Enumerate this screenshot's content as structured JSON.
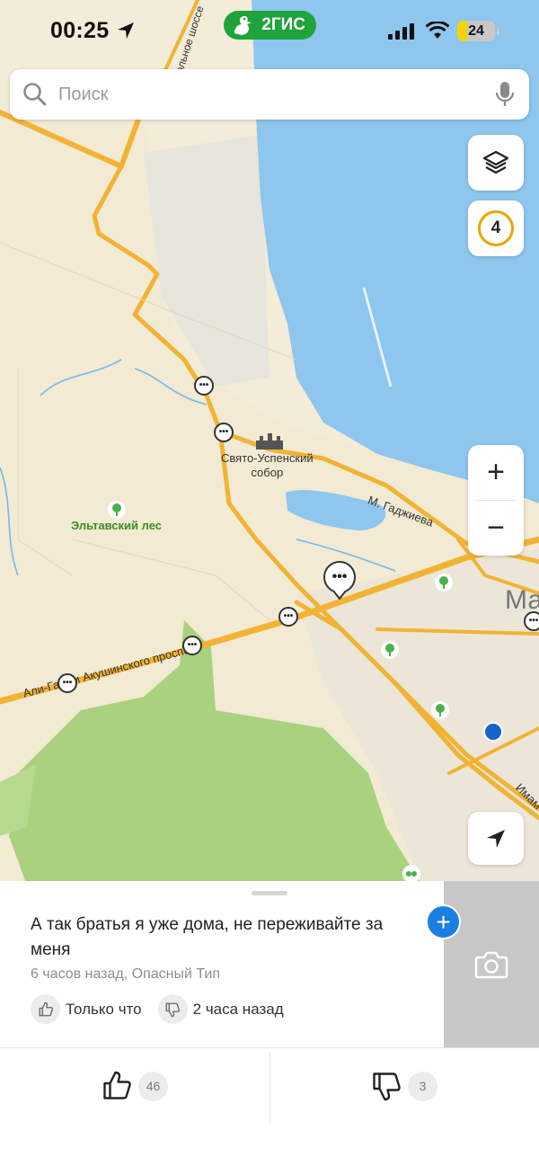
{
  "status_bar": {
    "time": "00:25",
    "battery": "24",
    "brand": "2ГИС"
  },
  "search": {
    "placeholder": "Поиск"
  },
  "map": {
    "labels": {
      "cathedral": "Свято-Успенский\nсобор",
      "forest": "Эльтавский лес",
      "street_gadzhieva": "М. Гаджиева",
      "street_akushinskogo": "Али-Гаджи Акушинского проспект",
      "highway_top": "ольное шоссе",
      "street_imama": "Имам",
      "city_partial": "Ма"
    },
    "events_count": "4",
    "zoom_in": "+",
    "zoom_out": "−",
    "colors": {
      "water": "#8ec6ee",
      "land": "#f3ecd8",
      "road": "#f2b335",
      "forest": "#a9d17e"
    }
  },
  "comment": {
    "text": "А так братья я уже дома, не переживайте за меня",
    "meta": "6 часов назад, Опасный Тип",
    "like_label": "Только что",
    "dislike_label": "2 часа назад"
  },
  "votes": {
    "likes": "46",
    "dislikes": "3"
  }
}
